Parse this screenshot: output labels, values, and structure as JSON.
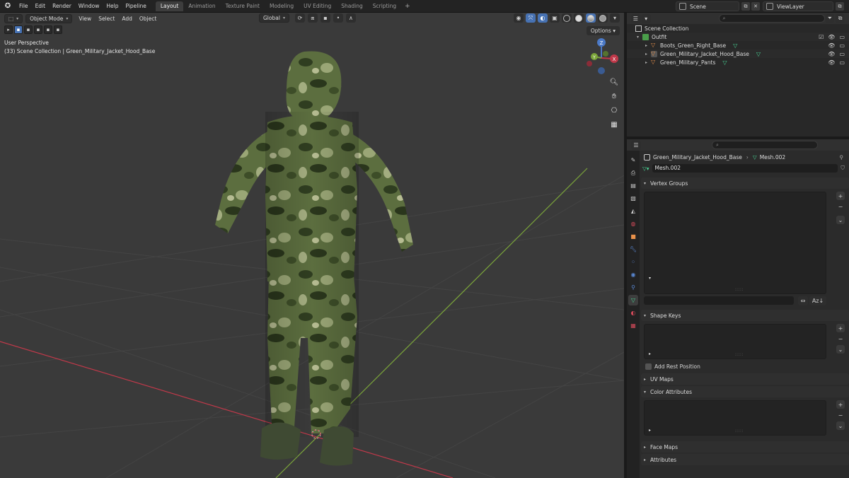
{
  "menubar": {
    "items": [
      "File",
      "Edit",
      "Render",
      "Window",
      "Help",
      "Pipeline"
    ],
    "workspace_tabs": [
      "Layout",
      "Animation",
      "Texture Paint",
      "Modeling",
      "UV Editing",
      "Shading",
      "Scripting"
    ],
    "active_tab": "Layout",
    "add_tab": "+",
    "scene": "Scene",
    "view_layer": "ViewLayer"
  },
  "viewport": {
    "mode": "Object Mode",
    "menus": [
      "View",
      "Select",
      "Add",
      "Object"
    ],
    "orientation": "Global",
    "options": "Options",
    "perspective_label": "User Perspective",
    "collection_label": "(33) Scene Collection | Green_Military_Jacket_Hood_Base",
    "gizmo": {
      "z": "Z",
      "y": "Y",
      "x": "X"
    },
    "icons": [
      "zoom-icon",
      "hand-icon",
      "camera-icon",
      "grid-icon"
    ]
  },
  "outliner": {
    "root": "Scene Collection",
    "collection": "Outfit",
    "objects": [
      {
        "name": "Boots_Green_Right_Base",
        "selected": false
      },
      {
        "name": "Green_Military_Jacket_Hood_Base",
        "selected": true
      },
      {
        "name": "Green_Military_Pants",
        "selected": false
      }
    ]
  },
  "properties": {
    "object_name": "Green_Military_Jacket_Hood_Base",
    "mesh_name": "Mesh.002",
    "panels": {
      "vertex_groups": "Vertex Groups",
      "shape_keys": "Shape Keys",
      "add_rest_position": "Add Rest Position",
      "uv_maps": "UV Maps",
      "color_attributes": "Color Attributes",
      "face_maps": "Face Maps",
      "attributes": "Attributes"
    }
  },
  "colors": {
    "accent": "#4772b3",
    "mesh_green": "#49d494",
    "object_orange": "#e8914b",
    "selection": "#334d80",
    "x_axis": "#c0394a",
    "y_axis": "#7ba53a"
  }
}
